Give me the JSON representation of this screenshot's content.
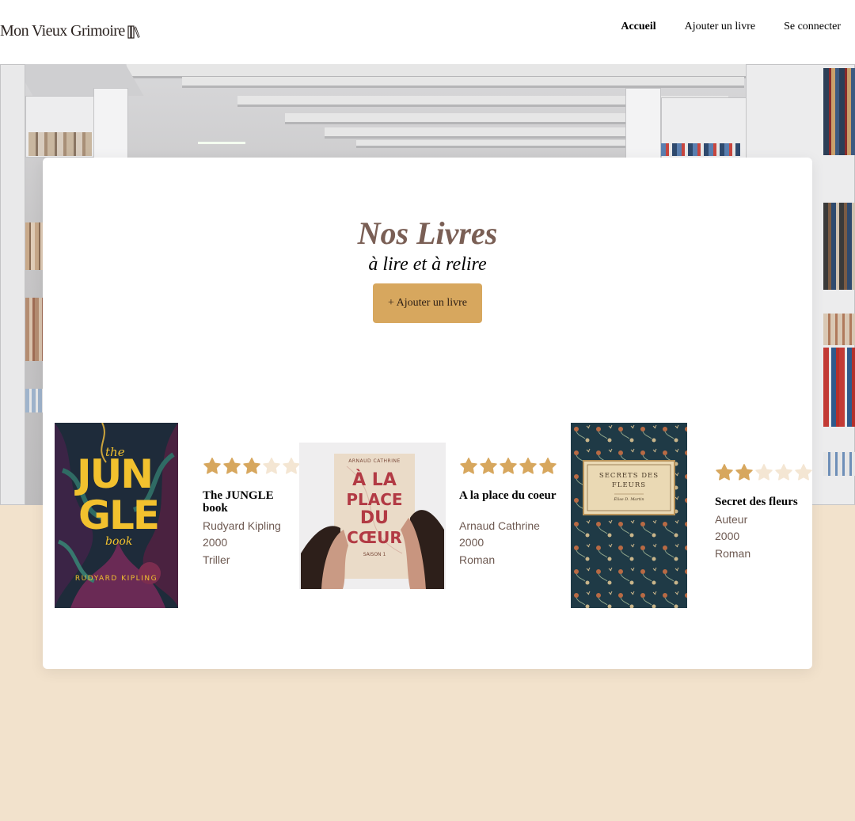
{
  "header": {
    "logo_text": "Mon Vieux Grimoire",
    "logo_icon": "books-icon",
    "nav": [
      {
        "label": "Accueil",
        "active": true
      },
      {
        "label": "Ajouter un livre",
        "active": false
      },
      {
        "label": "Se connecter",
        "active": false
      }
    ]
  },
  "main": {
    "title": "Nos Livres",
    "subtitle": "à lire et à relire",
    "add_button_label": "+ Ajouter un livre"
  },
  "books": [
    {
      "title": "The JUNGLE book",
      "author": "Rudyard Kipling",
      "year": "2000",
      "genre": "Triller",
      "rating": 3,
      "cover": {
        "line1": "the",
        "line2": "JUN",
        "line3": "GLE",
        "line4": "book",
        "author": "RUDYARD KIPLING"
      }
    },
    {
      "title": "A la place du coeur",
      "author": "Arnaud Cathrine",
      "year": "2000",
      "genre": "Roman",
      "rating": 5,
      "cover": {
        "author": "ARNAUD CATHRINE",
        "line1": "À LA",
        "line2": "PLACE",
        "line3": "DU",
        "line4": "CŒUR",
        "season": "SAISON 1"
      }
    },
    {
      "title": "Secret des fleurs",
      "author": "Auteur",
      "year": "2000",
      "genre": "Roman",
      "rating": 2,
      "cover": {
        "line1": "SECRETS DES",
        "line2": "FLEURS",
        "author": "Élise D. Martin"
      }
    }
  ],
  "colors": {
    "accent": "#d7a75e",
    "star_filled": "#d7a75e",
    "star_empty": "#f4e6d3",
    "title_color": "#7a5f55",
    "background": "#f2e2cc"
  }
}
